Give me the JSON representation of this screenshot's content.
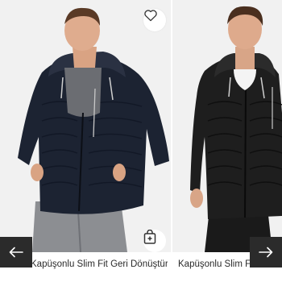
{
  "products": [
    {
      "title": "Kapüşonlu Slim Fit Geri Dönüştürül...",
      "favorite_icon": "heart-icon",
      "cart_icon": "shopping-bag-plus-icon",
      "jacket_color": "#1d2433"
    },
    {
      "title": "Kapüşonlu Slim Fit Geri Dönüştürül...",
      "jacket_color": "#1e1e1e"
    }
  ],
  "navigation": {
    "prev_icon": "arrow-left-icon",
    "next_icon": "arrow-right-icon",
    "button_color": "#2b2b2b"
  }
}
